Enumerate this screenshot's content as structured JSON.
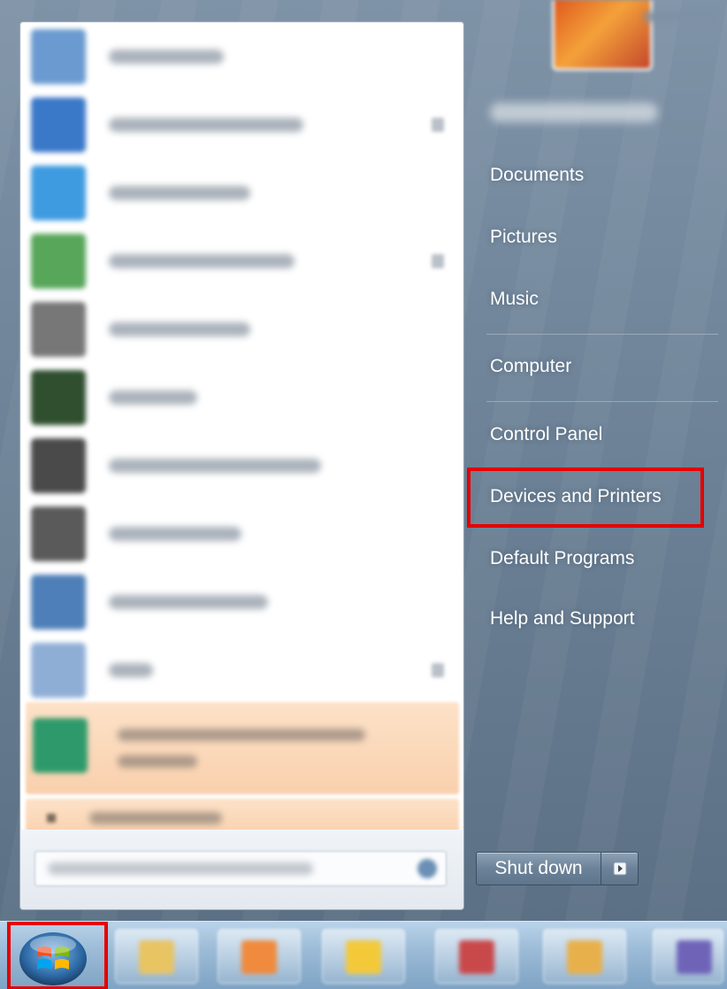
{
  "start_menu": {
    "right_links": [
      {
        "id": "documents",
        "label": "Documents"
      },
      {
        "id": "pictures",
        "label": "Pictures"
      },
      {
        "id": "music",
        "label": "Music"
      },
      {
        "id": "computer",
        "label": "Computer"
      },
      {
        "id": "control-panel",
        "label": "Control Panel"
      },
      {
        "id": "devices-and-printers",
        "label": "Devices and Printers",
        "highlighted": true
      },
      {
        "id": "default-programs",
        "label": "Default Programs"
      },
      {
        "id": "help-and-support",
        "label": "Help and Support"
      }
    ],
    "shutdown": {
      "label": "Shut down",
      "arrow_icon": "triangle-right-icon"
    }
  },
  "programs": [
    {
      "icon": "app-icon",
      "color": "#6a9ad0",
      "has_arrow": false
    },
    {
      "icon": "app-icon",
      "color": "#3a78c8",
      "has_arrow": true
    },
    {
      "icon": "app-icon",
      "color": "#3e9be0",
      "has_arrow": false
    },
    {
      "icon": "app-icon",
      "color": "#58a65a",
      "has_arrow": true
    },
    {
      "icon": "app-icon",
      "color": "#777777",
      "has_arrow": false
    },
    {
      "icon": "app-icon",
      "color": "#2f4f2f",
      "has_arrow": false
    },
    {
      "icon": "app-icon",
      "color": "#4a4a4a",
      "has_arrow": false
    },
    {
      "icon": "app-icon",
      "color": "#5a5a5a",
      "has_arrow": false
    },
    {
      "icon": "app-icon",
      "color": "#4e7fb8",
      "has_arrow": false
    },
    {
      "icon": "app-icon",
      "color": "#8faed6",
      "has_arrow": true
    }
  ],
  "highlight_color": "#e50000",
  "taskbar": {
    "start_button_icon": "windows-start-orb-icon",
    "pinned": [
      {
        "icon": "folder-icon",
        "color": "#e8c463"
      },
      {
        "icon": "media-icon",
        "color": "#f08a3c"
      },
      {
        "icon": "browser-icon",
        "color": "#f3c93a"
      },
      {
        "icon": "app-icon",
        "color": "#c9484a"
      },
      {
        "icon": "app-icon",
        "color": "#e8b04a"
      },
      {
        "icon": "app-icon",
        "color": "#6f63b8"
      }
    ]
  }
}
